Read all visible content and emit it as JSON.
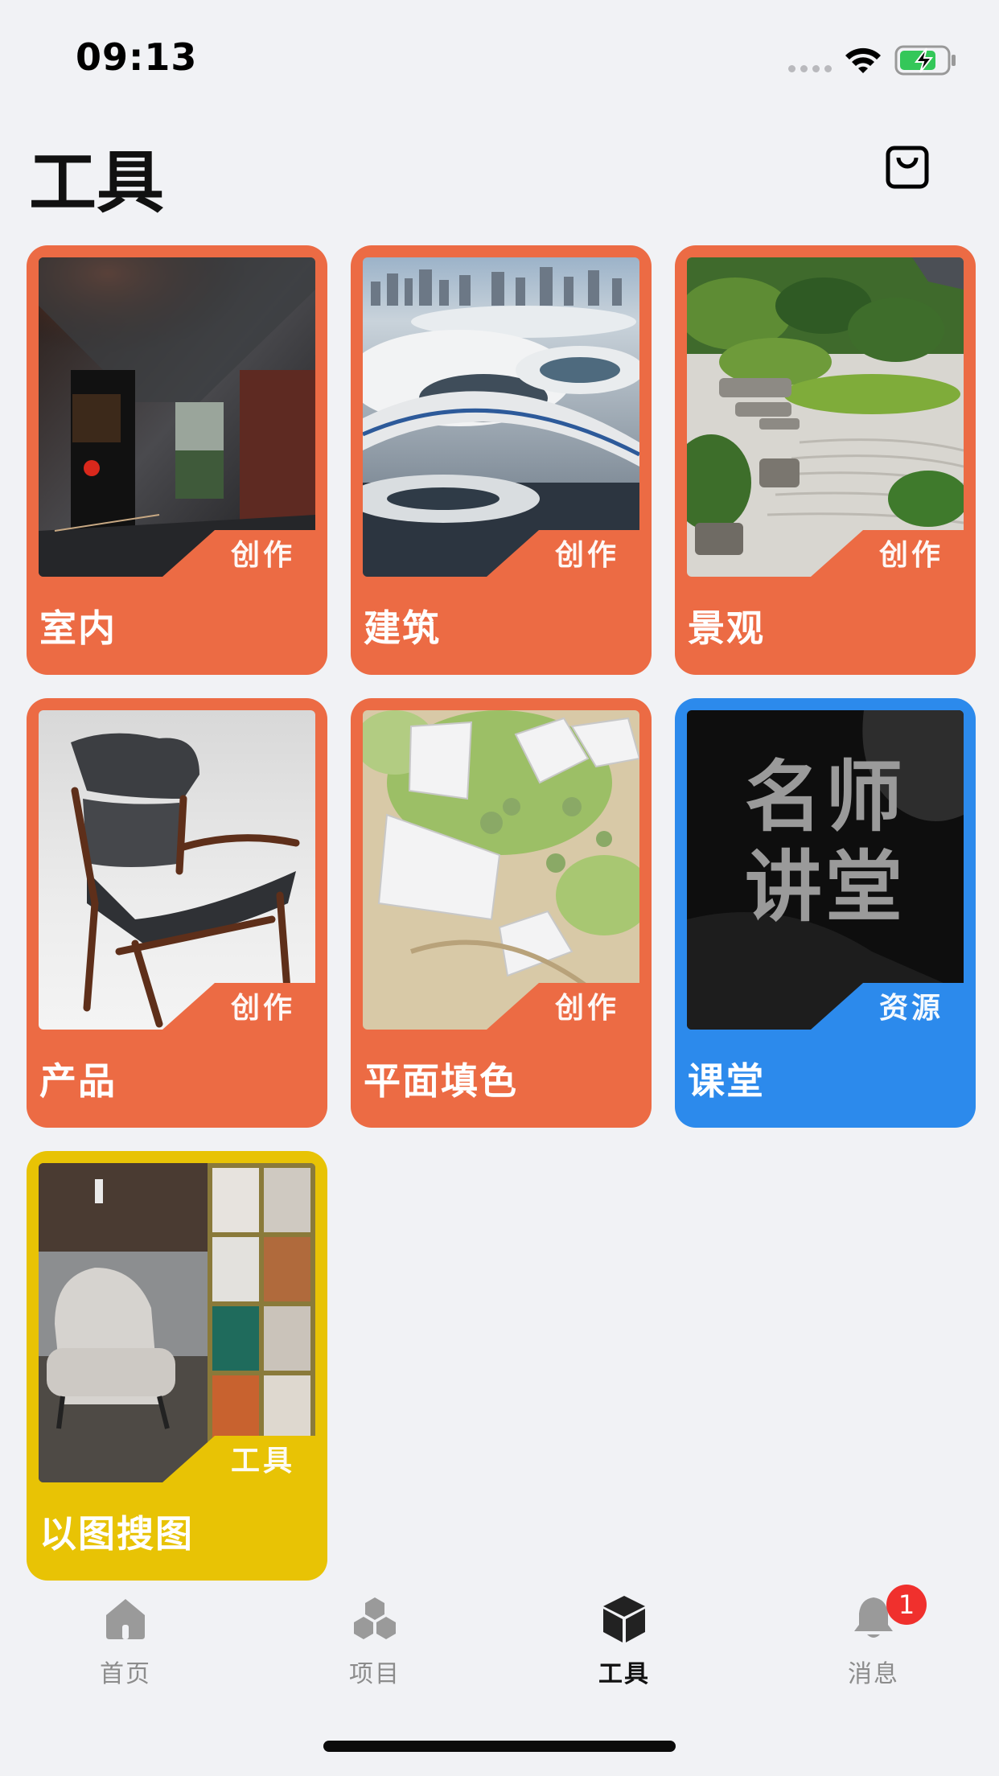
{
  "status_bar": {
    "time": "09:13"
  },
  "header": {
    "title": "工具"
  },
  "cards": [
    {
      "label": "室内",
      "tag": "创作",
      "color": "#ec6b44"
    },
    {
      "label": "建筑",
      "tag": "创作",
      "color": "#ec6b44"
    },
    {
      "label": "景观",
      "tag": "创作",
      "color": "#ec6b44"
    },
    {
      "label": "产品",
      "tag": "创作",
      "color": "#ec6b44"
    },
    {
      "label": "平面填色",
      "tag": "创作",
      "color": "#ec6b44"
    },
    {
      "label": "课堂",
      "tag": "资源",
      "color": "#2c8aec",
      "image_text": [
        "名师",
        "讲堂"
      ]
    },
    {
      "label": "以图搜图",
      "tag": "工具",
      "color": "#e8c305"
    }
  ],
  "tabbar": {
    "items": [
      {
        "label": "首页",
        "icon": "home-icon"
      },
      {
        "label": "项目",
        "icon": "project-icon"
      },
      {
        "label": "工具",
        "icon": "cube-icon",
        "active": true
      },
      {
        "label": "消息",
        "icon": "bell-icon",
        "badge": "1"
      }
    ]
  }
}
